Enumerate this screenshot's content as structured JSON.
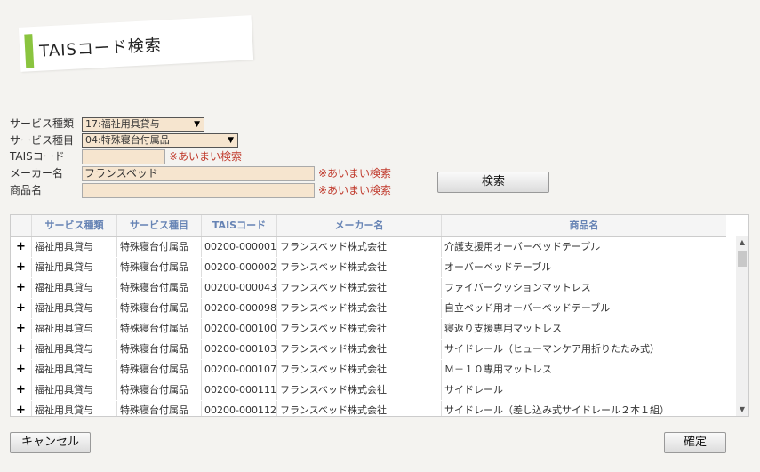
{
  "page": {
    "title": "TAISコード検索"
  },
  "form": {
    "service_type_label": "サービス種類",
    "service_type_value": "17:福祉用具貸与",
    "service_item_label": "サービス種目",
    "service_item_value": "04:特殊寝台付属品",
    "tais_code_label": "TAISコード",
    "tais_code_value": "",
    "tais_note": "※あいまい検索",
    "maker_label": "メーカー名",
    "maker_value": "フランスベッド",
    "maker_note": "※あいまい検索",
    "product_label": "商品名",
    "product_value": "",
    "product_note": "※あいまい検索",
    "search_button": "検索"
  },
  "table": {
    "columns": [
      "サービス種類",
      "サービス種目",
      "TAISコード",
      "メーカー名",
      "商品名"
    ],
    "expand_symbol": "+",
    "rows": [
      [
        "福祉用具貸与",
        "特殊寝台付属品",
        "00200-000001",
        "フランスベッド株式会社",
        "介護支援用オーバーベッドテーブル"
      ],
      [
        "福祉用具貸与",
        "特殊寝台付属品",
        "00200-000002",
        "フランスベッド株式会社",
        "オーバーベッドテーブル"
      ],
      [
        "福祉用具貸与",
        "特殊寝台付属品",
        "00200-000043",
        "フランスベッド株式会社",
        "ファイバークッションマットレス"
      ],
      [
        "福祉用具貸与",
        "特殊寝台付属品",
        "00200-000098",
        "フランスベッド株式会社",
        "自立ベッド用オーバーベッドテーブル"
      ],
      [
        "福祉用具貸与",
        "特殊寝台付属品",
        "00200-000100",
        "フランスベッド株式会社",
        "寝返り支援専用マットレス"
      ],
      [
        "福祉用具貸与",
        "特殊寝台付属品",
        "00200-000103",
        "フランスベッド株式会社",
        "サイドレール（ヒューマンケア用折りたたみ式）"
      ],
      [
        "福祉用具貸与",
        "特殊寝台付属品",
        "00200-000107",
        "フランスベッド株式会社",
        "Ｍ－１０専用マットレス"
      ],
      [
        "福祉用具貸与",
        "特殊寝台付属品",
        "00200-000111",
        "フランスベッド株式会社",
        "サイドレール"
      ],
      [
        "福祉用具貸与",
        "特殊寝台付属品",
        "00200-000112",
        "フランスベッド株式会社",
        "サイドレール（差し込み式サイドレール２本１組）"
      ]
    ]
  },
  "footer": {
    "cancel_button": "キャンセル",
    "confirm_button": "確定"
  },
  "colors": {
    "accent_green": "#8ac43f",
    "input_bg": "#f6e5cf",
    "note_red": "#c0392b",
    "header_text": "#6784b5"
  }
}
